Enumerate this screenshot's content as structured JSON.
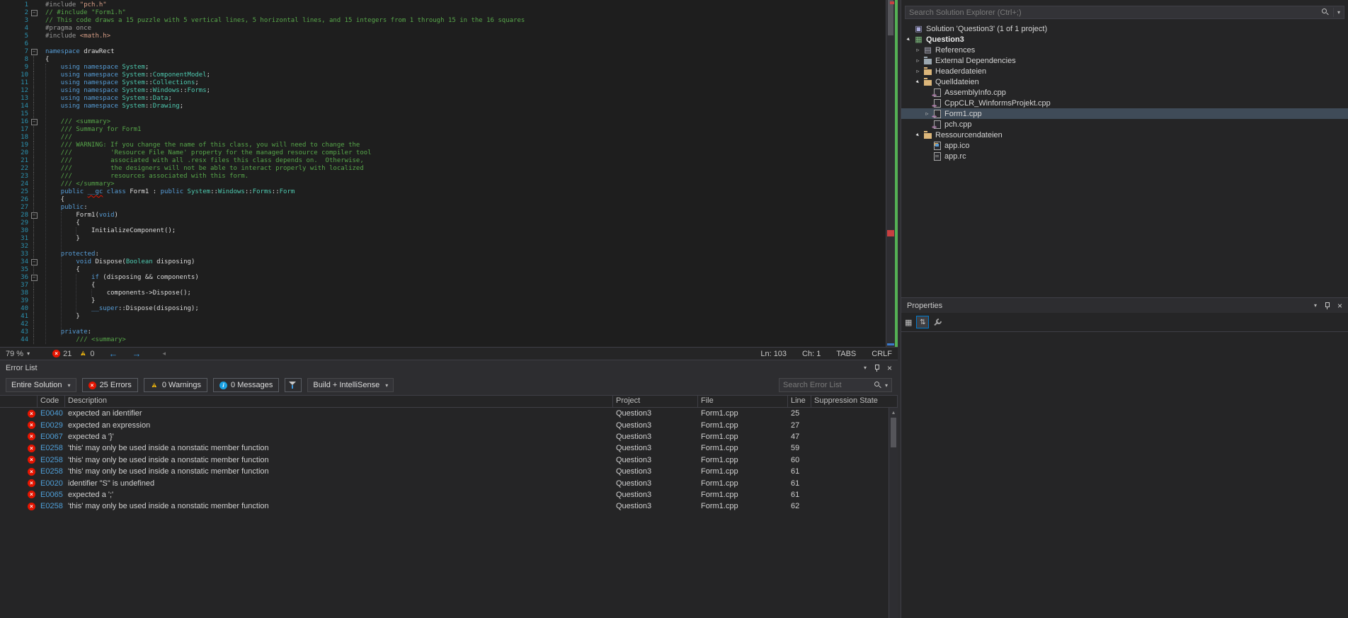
{
  "editor": {
    "lines": [
      {
        "n": 1,
        "f": "",
        "t": [
          [
            "p",
            "#include "
          ],
          [
            "s",
            "\"pch.h\""
          ]
        ]
      },
      {
        "n": 2,
        "f": "b",
        "t": [
          [
            "c",
            "// #include \"Form1.h\""
          ]
        ]
      },
      {
        "n": 3,
        "f": "",
        "t": [
          [
            "c",
            "// This code draws a 15 puzzle with 5 vertical lines, 5 horizontal lines, and 15 integers from 1 through 15 in the 16 squares"
          ]
        ]
      },
      {
        "n": 4,
        "f": "",
        "t": [
          [
            "p",
            "#pragma once"
          ]
        ]
      },
      {
        "n": 5,
        "f": "",
        "t": [
          [
            "p",
            "#include "
          ],
          [
            "s",
            "<math.h>"
          ]
        ]
      },
      {
        "n": 6,
        "f": "",
        "t": []
      },
      {
        "n": 7,
        "f": "b",
        "t": [
          [
            "k",
            "namespace"
          ],
          [
            "d",
            " drawRect"
          ]
        ]
      },
      {
        "n": 8,
        "f": "v",
        "t": [
          [
            "d",
            "{"
          ]
        ]
      },
      {
        "n": 9,
        "f": "v",
        "t": [
          [
            "d",
            "    "
          ],
          [
            "k",
            "using"
          ],
          [
            "d",
            " "
          ],
          [
            "k",
            "namespace"
          ],
          [
            "d",
            " "
          ],
          [
            "t",
            "System"
          ],
          [
            "d",
            ";"
          ]
        ]
      },
      {
        "n": 10,
        "f": "v",
        "t": [
          [
            "d",
            "    "
          ],
          [
            "k",
            "using"
          ],
          [
            "d",
            " "
          ],
          [
            "k",
            "namespace"
          ],
          [
            "d",
            " "
          ],
          [
            "t",
            "System"
          ],
          [
            "d",
            "::"
          ],
          [
            "t",
            "ComponentModel"
          ],
          [
            "d",
            ";"
          ]
        ]
      },
      {
        "n": 11,
        "f": "v",
        "t": [
          [
            "d",
            "    "
          ],
          [
            "k",
            "using"
          ],
          [
            "d",
            " "
          ],
          [
            "k",
            "namespace"
          ],
          [
            "d",
            " "
          ],
          [
            "t",
            "System"
          ],
          [
            "d",
            "::"
          ],
          [
            "t",
            "Collections"
          ],
          [
            "d",
            ";"
          ]
        ]
      },
      {
        "n": 12,
        "f": "v",
        "t": [
          [
            "d",
            "    "
          ],
          [
            "k",
            "using"
          ],
          [
            "d",
            " "
          ],
          [
            "k",
            "namespace"
          ],
          [
            "d",
            " "
          ],
          [
            "t",
            "System"
          ],
          [
            "d",
            "::"
          ],
          [
            "t",
            "Windows"
          ],
          [
            "d",
            "::"
          ],
          [
            "t",
            "Forms"
          ],
          [
            "d",
            ";"
          ]
        ]
      },
      {
        "n": 13,
        "f": "v",
        "t": [
          [
            "d",
            "    "
          ],
          [
            "k",
            "using"
          ],
          [
            "d",
            " "
          ],
          [
            "k",
            "namespace"
          ],
          [
            "d",
            " "
          ],
          [
            "t",
            "System"
          ],
          [
            "d",
            "::"
          ],
          [
            "t",
            "Data"
          ],
          [
            "d",
            ";"
          ]
        ]
      },
      {
        "n": 14,
        "f": "v",
        "t": [
          [
            "d",
            "    "
          ],
          [
            "k",
            "using"
          ],
          [
            "d",
            " "
          ],
          [
            "k",
            "namespace"
          ],
          [
            "d",
            " "
          ],
          [
            "t",
            "System"
          ],
          [
            "d",
            "::"
          ],
          [
            "t",
            "Drawing"
          ],
          [
            "d",
            ";"
          ]
        ]
      },
      {
        "n": 15,
        "f": "v",
        "t": []
      },
      {
        "n": 16,
        "f": "b",
        "t": [
          [
            "d",
            "    "
          ],
          [
            "c",
            "/// <summary>"
          ]
        ]
      },
      {
        "n": 17,
        "f": "v",
        "t": [
          [
            "d",
            "    "
          ],
          [
            "c",
            "/// Summary for Form1"
          ]
        ]
      },
      {
        "n": 18,
        "f": "v",
        "t": [
          [
            "d",
            "    "
          ],
          [
            "c",
            "///"
          ]
        ]
      },
      {
        "n": 19,
        "f": "v",
        "t": [
          [
            "d",
            "    "
          ],
          [
            "c",
            "/// WARNING: If you change the name of this class, you will need to change the"
          ]
        ]
      },
      {
        "n": 20,
        "f": "v",
        "t": [
          [
            "d",
            "    "
          ],
          [
            "c",
            "///          'Resource File Name' property for the managed resource compiler tool"
          ]
        ]
      },
      {
        "n": 21,
        "f": "v",
        "t": [
          [
            "d",
            "    "
          ],
          [
            "c",
            "///          associated with all .resx files this class depends on.  Otherwise,"
          ]
        ]
      },
      {
        "n": 22,
        "f": "v",
        "t": [
          [
            "d",
            "    "
          ],
          [
            "c",
            "///          the designers will not be able to interact properly with localized"
          ]
        ]
      },
      {
        "n": 23,
        "f": "v",
        "t": [
          [
            "d",
            "    "
          ],
          [
            "c",
            "///          resources associated with this form."
          ]
        ]
      },
      {
        "n": 24,
        "f": "v",
        "t": [
          [
            "d",
            "    "
          ],
          [
            "c",
            "/// </summary>"
          ]
        ]
      },
      {
        "n": 25,
        "f": "v",
        "t": [
          [
            "d",
            "    "
          ],
          [
            "k",
            "public"
          ],
          [
            "d",
            " "
          ],
          [
            "e",
            "__gc"
          ],
          [
            "d",
            " "
          ],
          [
            "k",
            "class"
          ],
          [
            "d",
            " Form1 : "
          ],
          [
            "k",
            "public"
          ],
          [
            "d",
            " "
          ],
          [
            "t",
            "System"
          ],
          [
            "d",
            "::"
          ],
          [
            "t",
            "Windows"
          ],
          [
            "d",
            "::"
          ],
          [
            "t",
            "Forms"
          ],
          [
            "d",
            "::"
          ],
          [
            "t",
            "Form"
          ]
        ]
      },
      {
        "n": 26,
        "f": "v",
        "t": [
          [
            "d",
            "    {"
          ]
        ]
      },
      {
        "n": 27,
        "f": "v",
        "t": [
          [
            "d",
            "    "
          ],
          [
            "k",
            "public"
          ],
          [
            "d",
            ":"
          ]
        ]
      },
      {
        "n": 28,
        "f": "b",
        "t": [
          [
            "d",
            "        Form1("
          ],
          [
            "k",
            "void"
          ],
          [
            "d",
            ")"
          ]
        ]
      },
      {
        "n": 29,
        "f": "v",
        "t": [
          [
            "d",
            "        {"
          ]
        ]
      },
      {
        "n": 30,
        "f": "v",
        "t": [
          [
            "d",
            "            InitializeComponent();"
          ]
        ]
      },
      {
        "n": 31,
        "f": "v",
        "t": [
          [
            "d",
            "        }"
          ]
        ]
      },
      {
        "n": 32,
        "f": "v",
        "t": []
      },
      {
        "n": 33,
        "f": "v",
        "t": [
          [
            "d",
            "    "
          ],
          [
            "k",
            "protected"
          ],
          [
            "d",
            ":"
          ]
        ]
      },
      {
        "n": 34,
        "f": "b",
        "t": [
          [
            "d",
            "        "
          ],
          [
            "k",
            "void"
          ],
          [
            "d",
            " Dispose("
          ],
          [
            "t",
            "Boolean"
          ],
          [
            "d",
            " disposing)"
          ]
        ]
      },
      {
        "n": 35,
        "f": "v",
        "t": [
          [
            "d",
            "        {"
          ]
        ]
      },
      {
        "n": 36,
        "f": "b",
        "t": [
          [
            "d",
            "            "
          ],
          [
            "k",
            "if"
          ],
          [
            "d",
            " (disposing && components)"
          ]
        ]
      },
      {
        "n": 37,
        "f": "v",
        "t": [
          [
            "d",
            "            {"
          ]
        ]
      },
      {
        "n": 38,
        "f": "v",
        "t": [
          [
            "d",
            "                components->Dispose();"
          ]
        ]
      },
      {
        "n": 39,
        "f": "v",
        "t": [
          [
            "d",
            "            }"
          ]
        ]
      },
      {
        "n": 40,
        "f": "v",
        "t": [
          [
            "d",
            "            "
          ],
          [
            "k",
            "__super"
          ],
          [
            "d",
            "::Dispose(disposing);"
          ]
        ]
      },
      {
        "n": 41,
        "f": "v",
        "t": [
          [
            "d",
            "        }"
          ]
        ]
      },
      {
        "n": 42,
        "f": "v",
        "t": []
      },
      {
        "n": 43,
        "f": "v",
        "t": [
          [
            "d",
            "    "
          ],
          [
            "k",
            "private"
          ],
          [
            "d",
            ":"
          ]
        ]
      },
      {
        "n": 44,
        "f": "v",
        "t": [
          [
            "d",
            "        "
          ],
          [
            "c",
            "/// <summary>"
          ]
        ]
      }
    ]
  },
  "statusbar": {
    "zoom": "79 %",
    "errors": "21",
    "warnings": "0",
    "line": "Ln: 103",
    "column": "Ch: 1",
    "tabs": "TABS",
    "eol": "CRLF"
  },
  "error_list": {
    "title": "Error List",
    "scope": "Entire Solution",
    "errors_btn": "25 Errors",
    "warnings_btn": "0 Warnings",
    "messages_btn": "0 Messages",
    "build_filter": "Build + IntelliSense",
    "search_placeholder": "Search Error List",
    "columns": [
      "Code",
      "Description",
      "Project",
      "File",
      "Line",
      "Suppression State"
    ],
    "rows": [
      {
        "code": "E0040",
        "description": "expected an identifier",
        "project": "Question3",
        "file": "Form1.cpp",
        "line": "25",
        "suppression": ""
      },
      {
        "code": "E0029",
        "description": "expected an expression",
        "project": "Question3",
        "file": "Form1.cpp",
        "line": "27",
        "suppression": ""
      },
      {
        "code": "E0067",
        "description": "expected a '}'",
        "project": "Question3",
        "file": "Form1.cpp",
        "line": "47",
        "suppression": ""
      },
      {
        "code": "E0258",
        "description": "'this' may only be used inside a nonstatic member function",
        "project": "Question3",
        "file": "Form1.cpp",
        "line": "59",
        "suppression": ""
      },
      {
        "code": "E0258",
        "description": "'this' may only be used inside a nonstatic member function",
        "project": "Question3",
        "file": "Form1.cpp",
        "line": "60",
        "suppression": ""
      },
      {
        "code": "E0258",
        "description": "'this' may only be used inside a nonstatic member function",
        "project": "Question3",
        "file": "Form1.cpp",
        "line": "61",
        "suppression": ""
      },
      {
        "code": "E0020",
        "description": "identifier \"S\" is undefined",
        "project": "Question3",
        "file": "Form1.cpp",
        "line": "61",
        "suppression": ""
      },
      {
        "code": "E0065",
        "description": "expected a ';'",
        "project": "Question3",
        "file": "Form1.cpp",
        "line": "61",
        "suppression": ""
      },
      {
        "code": "E0258",
        "description": "'this' may only be used inside a nonstatic member function",
        "project": "Question3",
        "file": "Form1.cpp",
        "line": "62",
        "suppression": ""
      }
    ]
  },
  "solution_explorer": {
    "search_placeholder": "Search Solution Explorer (Ctrl+;)",
    "tree": [
      {
        "indent": 0,
        "arrow": "",
        "icon": "solution",
        "label": "Solution 'Question3' (1 of 1 project)"
      },
      {
        "indent": 0,
        "arrow": "exp",
        "icon": "project",
        "label": "Question3",
        "bold": true
      },
      {
        "indent": 1,
        "arrow": "col",
        "icon": "references",
        "label": "References"
      },
      {
        "indent": 1,
        "arrow": "col",
        "icon": "folder-gray",
        "label": "External Dependencies"
      },
      {
        "indent": 1,
        "arrow": "col",
        "icon": "folder",
        "label": "Headerdateien"
      },
      {
        "indent": 1,
        "arrow": "exp",
        "icon": "folder",
        "label": "Quelldateien"
      },
      {
        "indent": 2,
        "arrow": "",
        "icon": "cpp",
        "label": "AssemblyInfo.cpp"
      },
      {
        "indent": 2,
        "arrow": "",
        "icon": "cpp",
        "label": "CppCLR_WinformsProjekt.cpp"
      },
      {
        "indent": 2,
        "arrow": "col",
        "icon": "cpp",
        "label": "Form1.cpp",
        "selected": true
      },
      {
        "indent": 2,
        "arrow": "",
        "icon": "cpp",
        "label": "pch.cpp"
      },
      {
        "indent": 1,
        "arrow": "exp",
        "icon": "folder",
        "label": "Ressourcendateien"
      },
      {
        "indent": 2,
        "arrow": "",
        "icon": "image",
        "label": "app.ico"
      },
      {
        "indent": 2,
        "arrow": "",
        "icon": "rc",
        "label": "app.rc"
      }
    ]
  },
  "properties": {
    "title": "Properties"
  }
}
